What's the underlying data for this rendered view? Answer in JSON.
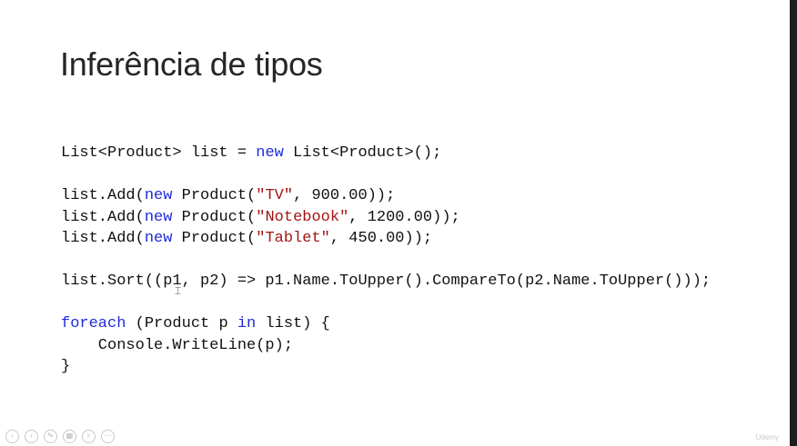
{
  "slide": {
    "title": "Inferência de tipos",
    "code_lines": [
      [
        {
          "t": "List<Product> list = "
        },
        {
          "t": "new",
          "c": "kw"
        },
        {
          "t": " List<Product>();"
        }
      ],
      [],
      [
        {
          "t": "list.Add("
        },
        {
          "t": "new",
          "c": "kw"
        },
        {
          "t": " Product("
        },
        {
          "t": "\"TV\"",
          "c": "str"
        },
        {
          "t": ", 900.00));"
        }
      ],
      [
        {
          "t": "list.Add("
        },
        {
          "t": "new",
          "c": "kw"
        },
        {
          "t": " Product("
        },
        {
          "t": "\"Notebook\"",
          "c": "str"
        },
        {
          "t": ", 1200.00));"
        }
      ],
      [
        {
          "t": "list.Add("
        },
        {
          "t": "new",
          "c": "kw"
        },
        {
          "t": " Product("
        },
        {
          "t": "\"Tablet\"",
          "c": "str"
        },
        {
          "t": ", 450.00));"
        }
      ],
      [],
      [
        {
          "t": "list.Sort((p1, p2) => p1.Name.ToUpper().CompareTo(p2.Name.ToUpper()));"
        }
      ],
      [],
      [
        {
          "t": "foreach",
          "c": "kw"
        },
        {
          "t": " (Product p "
        },
        {
          "t": "in",
          "c": "kw"
        },
        {
          "t": " list) {"
        }
      ],
      [
        {
          "t": "    Console.WriteLine(p);"
        }
      ],
      [
        {
          "t": "}"
        }
      ]
    ],
    "watermark": "Udemy"
  },
  "controls": [
    {
      "name": "previous-slide-button",
      "icon": "‹"
    },
    {
      "name": "next-slide-button",
      "icon": "›"
    },
    {
      "name": "pen-tool-button",
      "icon": "✎"
    },
    {
      "name": "slides-overview-button",
      "icon": "▦"
    },
    {
      "name": "zoom-button",
      "icon": "⌕"
    },
    {
      "name": "more-options-button",
      "icon": "⋯"
    }
  ],
  "colors": {
    "keyword": "#1f2bd9",
    "string": "#a31515",
    "text": "#111111"
  }
}
